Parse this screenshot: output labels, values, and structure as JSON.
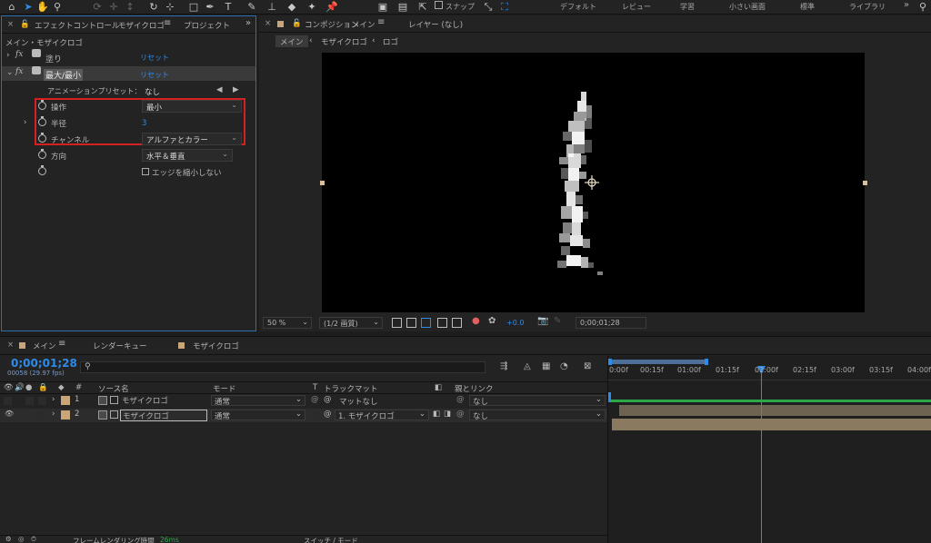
{
  "toolbar": {
    "snap_label": "スナップ",
    "workspaces": [
      "デフォルト",
      "レビュー",
      "学習",
      "小さい画面",
      "標準",
      "ライブラリ"
    ],
    "overflow": "»"
  },
  "effects_panel": {
    "tab_label": "エフェクトコントロール",
    "tab_target": "モザイクロゴ",
    "project_tab": "プロジェクト",
    "breadcrumb": "メイン・モザイクロゴ",
    "effects": [
      {
        "name": "塗り",
        "reset": "リセット"
      },
      {
        "name": "最大/最小",
        "reset": "リセット"
      }
    ],
    "preset_label": "アニメーションプリセット：",
    "preset_value": "なし",
    "props": {
      "operation": {
        "label": "操作",
        "value": "最小"
      },
      "radius": {
        "label": "半径",
        "value": "3"
      },
      "channel": {
        "label": "チャンネル",
        "value": "アルファとカラー"
      },
      "direction": {
        "label": "方向",
        "value": "水平＆垂直"
      },
      "edge": {
        "label": "エッジを縮小しない"
      }
    }
  },
  "comp_panel": {
    "tab_label": "コンポジション",
    "tab_target": "メイン",
    "layer_tab": "レイヤー (なし)",
    "breadcrumb": [
      "メイン",
      "モザイクロゴ",
      "ロゴ"
    ],
    "zoom": "50 %",
    "resolution": "(1/2 画質)",
    "exposure": "+0.0",
    "timecode": "0;00;01;28"
  },
  "timeline": {
    "tabs": [
      "メイン",
      "レンダーキュー",
      "モザイクロゴ"
    ],
    "timecode": "0;00;01;28",
    "frames": "00058 (29.97 fps)",
    "search_placeholder": "",
    "columns": {
      "num": "#",
      "source": "ソース名",
      "mode": "モード",
      "trkmat_t": "T",
      "trkmat": "トラックマット",
      "parent": "親とリンク"
    },
    "layers": [
      {
        "num": "1",
        "name": "モザイクロゴ",
        "mode": "通常",
        "matte": "マットなし",
        "parent": "なし"
      },
      {
        "num": "2",
        "name": "モザイクロゴ",
        "mode": "通常",
        "matte": "1. モザイクロゴ",
        "parent": "なし"
      }
    ],
    "ruler": [
      "0:00f",
      "00:15f",
      "01:00f",
      "01:15f",
      "02:00f",
      "02:15f",
      "03:00f",
      "03:15f",
      "04:00f"
    ],
    "bottom_label": "フレームレンダリング時間",
    "bottom_value": "26ms",
    "switch_label": "スイッチ / モード"
  },
  "colors": {
    "accent": "#2d8ceb",
    "highlight": "#d32020",
    "label_tan": "#c8a67a"
  }
}
